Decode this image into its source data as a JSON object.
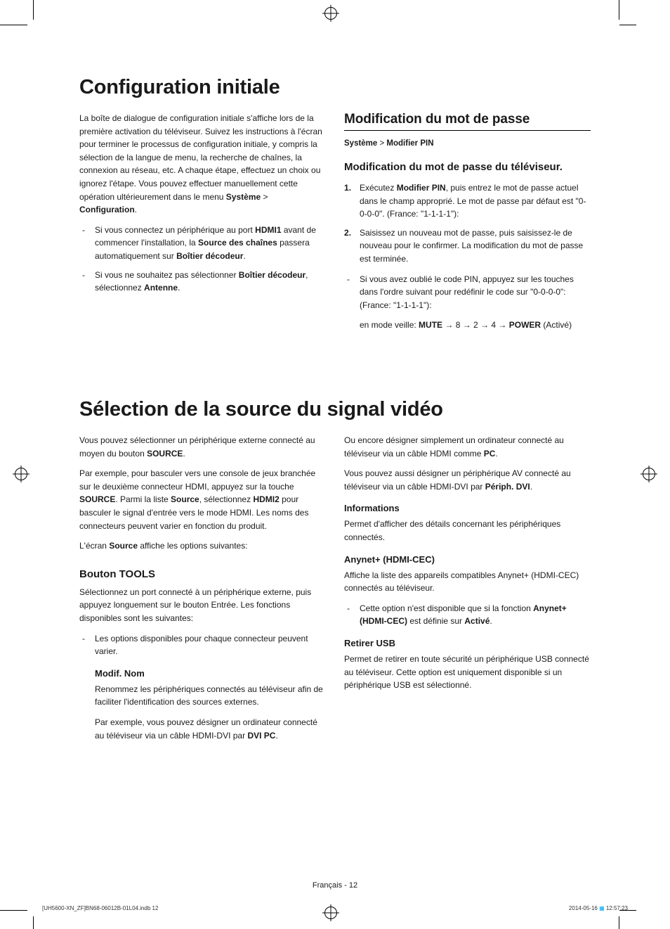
{
  "section1": {
    "title": "Configuration initiale",
    "left": {
      "intro": "La boîte de dialogue de configuration initiale s'affiche lors de la première activation du téléviseur. Suivez les instructions à l'écran pour terminer le processus de configuration initiale, y compris la sélection de la langue de menu, la recherche de chaînes, la connexion au réseau, etc. A chaque étape, effectuez un choix ou ignorez l'étape. Vous pouvez effectuer manuellement cette opération ultérieurement dans le menu ",
      "intro_bold1": "Système",
      "intro_gt": " > ",
      "intro_bold2": "Configuration",
      "intro_end": ".",
      "bullets": [
        {
          "pre": "Si vous connectez un périphérique au port ",
          "b1": "HDMI1",
          "mid": " avant de commencer l'installation, la ",
          "b2": "Source des chaînes",
          "mid2": " passera automatiquement sur ",
          "b3": "Boîtier décodeur",
          "end": "."
        },
        {
          "pre": "Si vous ne souhaitez pas sélectionner ",
          "b1": "Boîtier décodeur",
          "mid": ", sélectionnez ",
          "b2": "Antenne",
          "end": "."
        }
      ]
    },
    "right": {
      "heading": "Modification du mot de passe",
      "breadcrumb": {
        "a": "Système",
        "gt": " > ",
        "b": "Modifier PIN"
      },
      "subheading": "Modification du mot de passe du téléviseur.",
      "steps": [
        {
          "pre": "Exécutez ",
          "b1": "Modifier PIN",
          "rest": ", puis entrez le mot de passe actuel dans le champ approprié. Le mot de passe par défaut est \"0-0-0-0\". (France: \"1-1-1-1\"):"
        },
        {
          "pre": "",
          "b1": "",
          "rest": "Saisissez un nouveau mot de passe, puis saisissez-le de nouveau pour le confirmer. La modification du mot de passe est terminée."
        }
      ],
      "forgot_bullet": "Si vous avez oublié le code PIN, appuyez sur les touches dans l'ordre suivant pour redéfinir le code sur \"0-0-0-0\": (France: \"1-1-1-1\"):",
      "standby_pre": "en mode veille: ",
      "standby_seq": {
        "b1": "MUTE",
        "a": " → 8 → 2 → 4 → ",
        "b2": "POWER",
        "end": " (Activé)"
      }
    }
  },
  "section2": {
    "title": "Sélection de la source du signal vidéo",
    "left": {
      "p1_pre": "Vous pouvez sélectionner un périphérique externe connecté au moyen du bouton ",
      "p1_b": "SOURCE",
      "p1_end": ".",
      "p2_pre": "Par exemple, pour basculer vers une console de jeux branchée sur le deuxième connecteur HDMI, appuyez sur la touche ",
      "p2_b1": "SOURCE",
      "p2_mid": ". Parmi la liste ",
      "p2_b2": "Source",
      "p2_mid2": ", sélectionnez ",
      "p2_b3": "HDMI2",
      "p2_end": " pour basculer le signal d'entrée vers le mode HDMI. Les noms des connecteurs peuvent varier en fonction du produit.",
      "p3_pre": "L'écran ",
      "p3_b": "Source",
      "p3_end": " affiche les options suivantes:",
      "tools_heading": "Bouton TOOLS",
      "tools_desc": "Sélectionnez un port connecté à un périphérique externe, puis appuyez longuement sur le bouton Entrée. Les fonctions disponibles sont les suivantes:",
      "tools_bullet": "Les options disponibles pour chaque connecteur peuvent varier.",
      "modif_heading": "Modif. Nom",
      "modif_p1": "Renommez les périphériques connectés au téléviseur afin de faciliter l'identification des sources externes.",
      "modif_p2_pre": "Par exemple, vous pouvez désigner un ordinateur connecté au téléviseur via un câble HDMI-DVI par ",
      "modif_p2_b": "DVI PC",
      "modif_p2_end": "."
    },
    "right": {
      "p1_pre": "Ou encore désigner simplement un ordinateur connecté au téléviseur via un câble HDMI comme ",
      "p1_b": "PC",
      "p1_end": ".",
      "p2_pre": "Vous pouvez aussi désigner un périphérique AV connecté au téléviseur via un câble HDMI-DVI par ",
      "p2_b": "Périph. DVI",
      "p2_end": ".",
      "info_heading": "Informations",
      "info_p": "Permet d'afficher des détails concernant les périphériques connectés.",
      "anynet_heading": "Anynet+ (HDMI-CEC)",
      "anynet_p": "Affiche la liste des appareils compatibles Anynet+ (HDMI-CEC) connectés au téléviseur.",
      "anynet_bullet_pre": "Cette option n'est disponible que si la fonction ",
      "anynet_bullet_b": "Anynet+ (HDMI-CEC)",
      "anynet_bullet_mid": " est définie sur ",
      "anynet_bullet_b2": "Activé",
      "anynet_bullet_end": ".",
      "usb_heading": "Retirer USB",
      "usb_p": "Permet de retirer en toute sécurité un périphérique USB connecté au téléviseur. Cette option est uniquement disponible si un périphérique USB est sélectionné."
    }
  },
  "footer": {
    "center": "Français - 12",
    "left": "[UH5600-XN_ZF]BN68-06012B-01L04.indb   12",
    "right_date": "2014-05-16   ",
    "right_time": "12:57:23"
  }
}
